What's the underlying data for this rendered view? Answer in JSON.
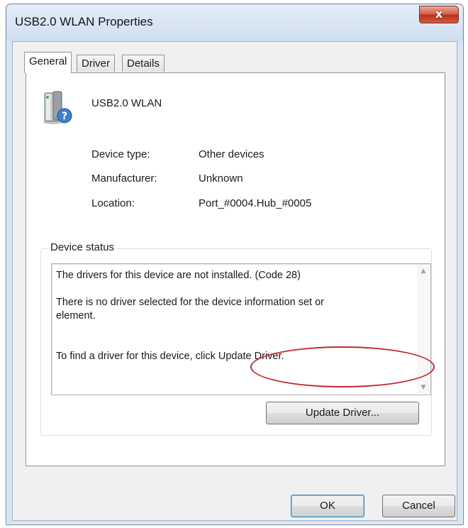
{
  "window": {
    "title": "USB2.0 WLAN Properties"
  },
  "tabs": [
    {
      "label": "General"
    },
    {
      "label": "Driver"
    },
    {
      "label": "Details"
    }
  ],
  "device": {
    "name": "USB2.0 WLAN",
    "icon": "unknown-device-icon"
  },
  "properties": [
    {
      "label": "Device type:",
      "value": "Other devices"
    },
    {
      "label": "Manufacturer:",
      "value": "Unknown"
    },
    {
      "label": "Location:",
      "value": "Port_#0004.Hub_#0005"
    }
  ],
  "device_status": {
    "title": "Device status",
    "text": "The drivers for this device are not installed. (Code 28)\n\nThere is no driver selected for the device information set or\nelement.\n\n\nTo find a driver for this device, click Update Driver."
  },
  "buttons": {
    "update_driver": "Update Driver...",
    "ok": "OK",
    "cancel": "Cancel",
    "close": "x"
  },
  "colors": {
    "highlight": "#c0282e",
    "close_button": "#c0432b"
  }
}
